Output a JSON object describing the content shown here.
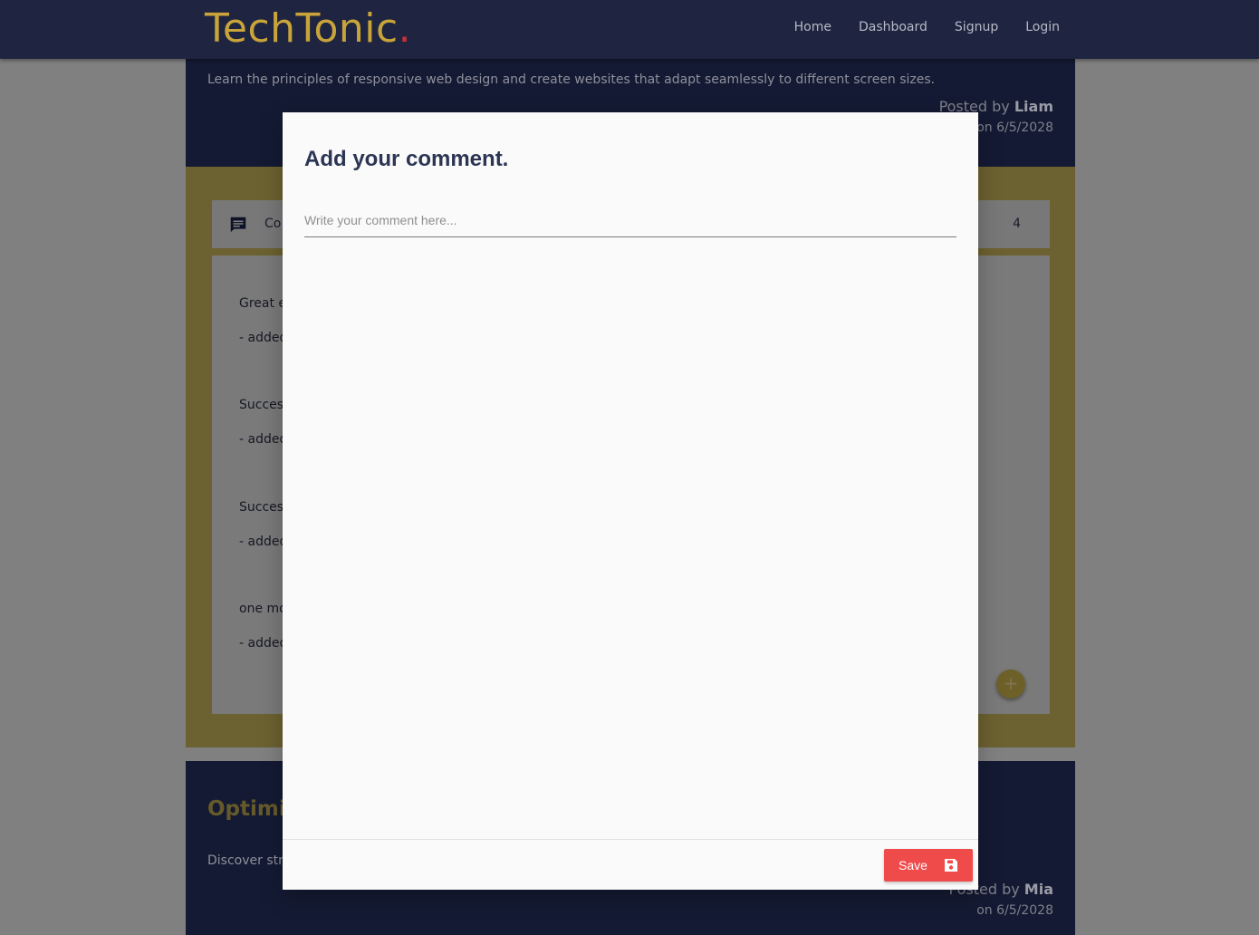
{
  "brand": {
    "name": "TechTonic",
    "dot": "."
  },
  "nav": {
    "items": [
      "Home",
      "Dashboard",
      "Signup",
      "Login"
    ]
  },
  "post1": {
    "description": "Learn the principles of responsive web design and create websites that adapt seamlessly to different screen sizes.",
    "posted_by_prefix": "Posted by",
    "author": "Liam",
    "date": "on 6/5/2028"
  },
  "comments": {
    "header_label": "Co",
    "count": "4",
    "items": [
      {
        "text": "Great e",
        "by": "- added"
      },
      {
        "text": "Success",
        "by": "- added"
      },
      {
        "text": "Success",
        "by": "- added"
      },
      {
        "text": "one mo",
        "by": "- added"
      }
    ],
    "fab_label": "+"
  },
  "post2": {
    "title": "Optimi",
    "description": "Discover stra",
    "posted_by_prefix": "Posted by",
    "author": "Mia",
    "date": "on 6/5/2028"
  },
  "modal": {
    "title": "Add your comment.",
    "input_placeholder": "Write your comment here...",
    "input_value": "",
    "save_label": "Save"
  },
  "colors": {
    "navbar": "#1f2540",
    "brand": "#c9a43a",
    "accent_gold": "#e8c84a",
    "save_button": "#f04b4b"
  }
}
